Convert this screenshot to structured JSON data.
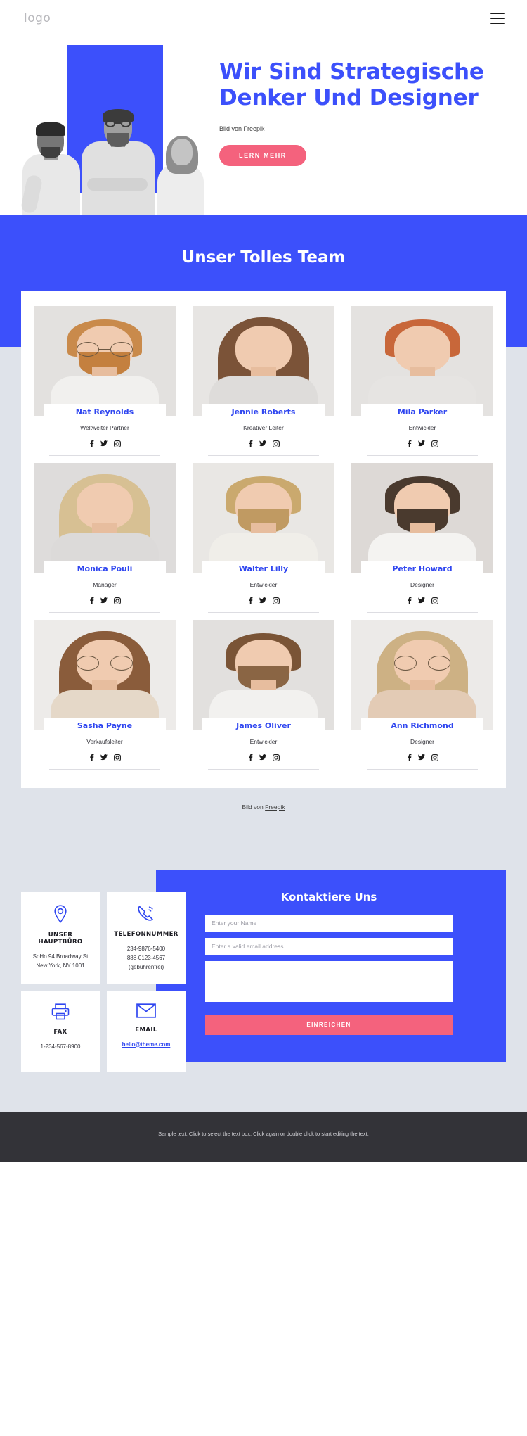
{
  "header": {
    "logo_text": "logo",
    "menu_icon": "hamburger-menu-icon"
  },
  "hero": {
    "title": "Wir Sind Strategische Denker Und Designer",
    "credit_prefix": "Bild von ",
    "credit_link": "Freepik",
    "cta_label": "LERN MEHR",
    "accent_blue": "#3c50fb",
    "cta_color": "#f4627d"
  },
  "team": {
    "heading": "Unser Tolles Team",
    "credit_prefix": "Bild von ",
    "credit_link": "Freepik",
    "social": [
      "facebook-icon",
      "twitter-icon",
      "instagram-icon"
    ],
    "members": [
      {
        "name": "Nat Reynolds",
        "role": "Weltweiter Partner"
      },
      {
        "name": "Jennie Roberts",
        "role": "Kreativer Leiter"
      },
      {
        "name": "Mila Parker",
        "role": "Entwickler"
      },
      {
        "name": "Monica Pouli",
        "role": "Manager"
      },
      {
        "name": "Walter Lilly",
        "role": "Entwickler"
      },
      {
        "name": "Peter Howard",
        "role": "Designer"
      },
      {
        "name": "Sasha Payne",
        "role": "Verkaufsleiter"
      },
      {
        "name": "James Oliver",
        "role": "Entwickler"
      },
      {
        "name": "Ann Richmond",
        "role": "Designer"
      }
    ]
  },
  "contact": {
    "form_title": "Kontaktiere Uns",
    "name_placeholder": "Enter your Name",
    "email_placeholder": "Enter a valid email address",
    "message_placeholder": "",
    "submit_label": "EINREICHEN",
    "cards": [
      {
        "icon": "location-pin-icon",
        "title": "UNSER HAUPTBÜRO",
        "lines": [
          "SoHo 94 Broadway St",
          "New York, NY 1001"
        ],
        "link": ""
      },
      {
        "icon": "phone-icon",
        "title": "TELEFONNUMMER",
        "lines": [
          "234-9876-5400",
          "888-0123-4567",
          "(gebührenfrei)"
        ],
        "link": ""
      },
      {
        "icon": "fax-icon",
        "title": "FAX",
        "lines": [
          "1-234-567-8900"
        ],
        "link": ""
      },
      {
        "icon": "envelope-icon",
        "title": "EMAIL",
        "lines": [],
        "link": "hello@theme.com"
      }
    ]
  },
  "footer": {
    "text": "Sample text. Click to select the text box. Click again or double click to start editing the text."
  }
}
